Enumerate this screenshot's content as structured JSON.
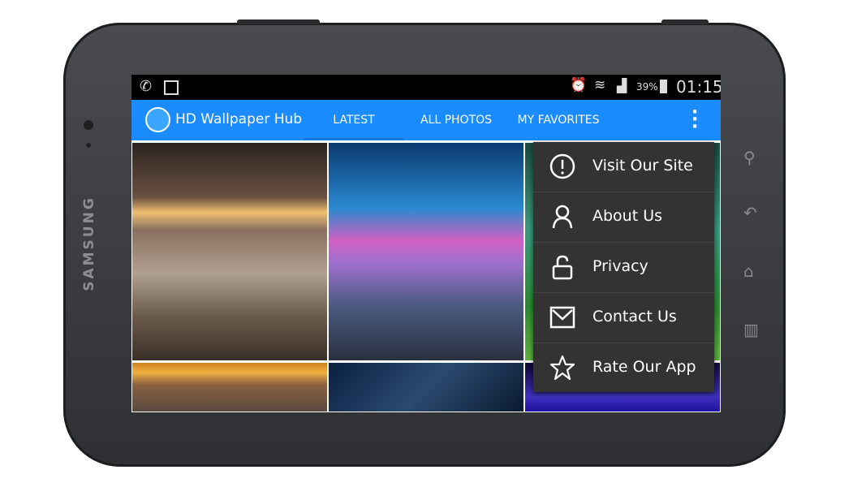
{
  "device": {
    "brand": "SAMSUNG"
  },
  "status_bar": {
    "time": "01:15",
    "battery": "39%",
    "icons": [
      "whatsapp-icon",
      "gallery-icon",
      "alarm-icon",
      "wifi-icon",
      "signal-icon",
      "battery-charging-icon"
    ]
  },
  "app_bar": {
    "title": "HD Wallpaper Hub",
    "tabs": [
      {
        "label": "LATEST",
        "active": true
      },
      {
        "label": "ALL PHOTOS"
      },
      {
        "label": "MY FAVORITES"
      }
    ],
    "accent": "#1a8cff"
  },
  "menu": {
    "items": [
      {
        "label": "Visit Our Site",
        "icon": "info-circle-icon"
      },
      {
        "label": "About Us",
        "icon": "person-icon"
      },
      {
        "label": "Privacy",
        "icon": "unlock-icon"
      },
      {
        "label": "Contact Us",
        "icon": "mail-icon"
      },
      {
        "label": "Rate Our App",
        "icon": "star-icon"
      }
    ]
  }
}
